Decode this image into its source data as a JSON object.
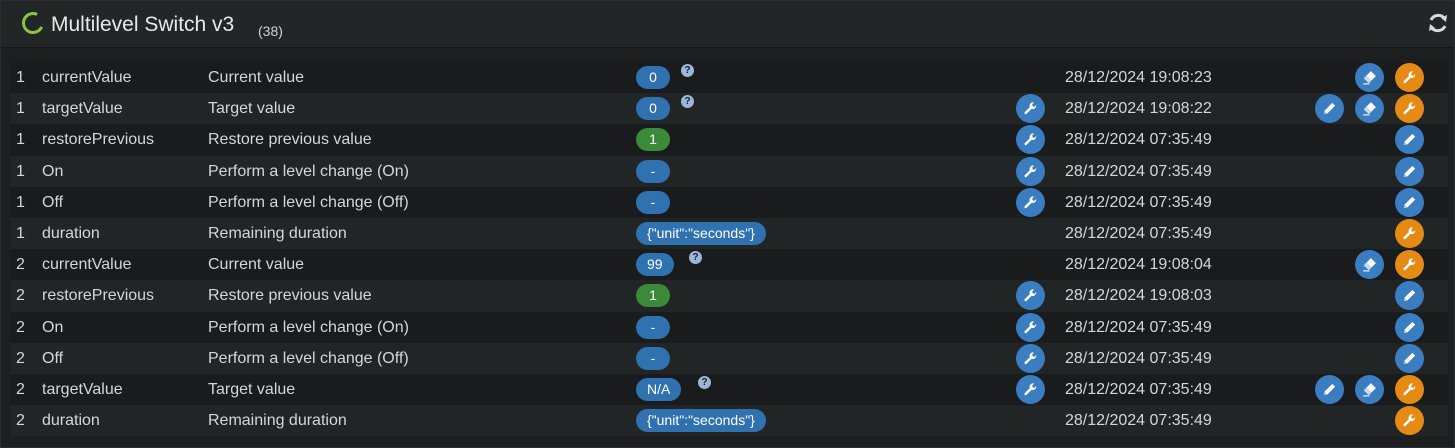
{
  "header": {
    "title": "Multilevel Switch v3",
    "count": "(38)"
  },
  "rows": [
    {
      "inst": "1",
      "key": "currentValue",
      "label": "Current value",
      "value": "0",
      "value_style": "blue",
      "help": true,
      "config": false,
      "date": "28/12/2024 19:08:23",
      "edit": false,
      "eraser": true,
      "wrench": true
    },
    {
      "inst": "1",
      "key": "targetValue",
      "label": "Target value",
      "value": "0",
      "value_style": "blue",
      "help": true,
      "config": true,
      "date": "28/12/2024 19:08:22",
      "edit": true,
      "eraser": true,
      "wrench": true
    },
    {
      "inst": "1",
      "key": "restorePrevious",
      "label": "Restore previous value",
      "value": "1",
      "value_style": "green",
      "help": false,
      "config": true,
      "date": "28/12/2024 07:35:49",
      "edit": true,
      "eraser": false,
      "wrench": false
    },
    {
      "inst": "1",
      "key": "On",
      "label": "Perform a level change (On)",
      "value": "-",
      "value_style": "blue",
      "help": false,
      "config": true,
      "date": "28/12/2024 07:35:49",
      "edit": true,
      "eraser": false,
      "wrench": false
    },
    {
      "inst": "1",
      "key": "Off",
      "label": "Perform a level change (Off)",
      "value": "-",
      "value_style": "blue",
      "help": false,
      "config": true,
      "date": "28/12/2024 07:35:49",
      "edit": true,
      "eraser": false,
      "wrench": false
    },
    {
      "inst": "1",
      "key": "duration",
      "label": "Remaining duration",
      "value": "{\"unit\":\"seconds\"}",
      "value_style": "blue",
      "help": false,
      "config": false,
      "date": "28/12/2024 07:35:49",
      "edit": false,
      "eraser": false,
      "wrench": true
    },
    {
      "inst": "2",
      "key": "currentValue",
      "label": "Current value",
      "value": "99",
      "value_style": "blue",
      "help": true,
      "config": false,
      "date": "28/12/2024 19:08:04",
      "edit": false,
      "eraser": true,
      "wrench": true
    },
    {
      "inst": "2",
      "key": "restorePrevious",
      "label": "Restore previous value",
      "value": "1",
      "value_style": "green",
      "help": false,
      "config": true,
      "date": "28/12/2024 19:08:03",
      "edit": true,
      "eraser": false,
      "wrench": false
    },
    {
      "inst": "2",
      "key": "On",
      "label": "Perform a level change (On)",
      "value": "-",
      "value_style": "blue",
      "help": false,
      "config": true,
      "date": "28/12/2024 07:35:49",
      "edit": true,
      "eraser": false,
      "wrench": false
    },
    {
      "inst": "2",
      "key": "Off",
      "label": "Perform a level change (Off)",
      "value": "-",
      "value_style": "blue",
      "help": false,
      "config": true,
      "date": "28/12/2024 07:35:49",
      "edit": true,
      "eraser": false,
      "wrench": false
    },
    {
      "inst": "2",
      "key": "targetValue",
      "label": "Target value",
      "value": "N/A",
      "value_style": "blue",
      "help": true,
      "config": true,
      "date": "28/12/2024 07:35:49",
      "edit": true,
      "eraser": true,
      "wrench": true
    },
    {
      "inst": "2",
      "key": "duration",
      "label": "Remaining duration",
      "value": "{\"unit\":\"seconds\"}",
      "value_style": "blue",
      "help": false,
      "config": false,
      "date": "28/12/2024 07:35:49",
      "edit": false,
      "eraser": false,
      "wrench": true
    }
  ],
  "colors": {
    "accent_blue": "#3a7dc0",
    "accent_orange": "#e58a14",
    "status_green": "#8cc63f",
    "pill_green": "#3a8a3a"
  },
  "icons": {
    "status": "status-ring-icon",
    "refresh": "refresh-icon",
    "help": "help-icon",
    "wrench": "wrench-icon",
    "edit": "pencil-icon",
    "eraser": "eraser-icon"
  }
}
